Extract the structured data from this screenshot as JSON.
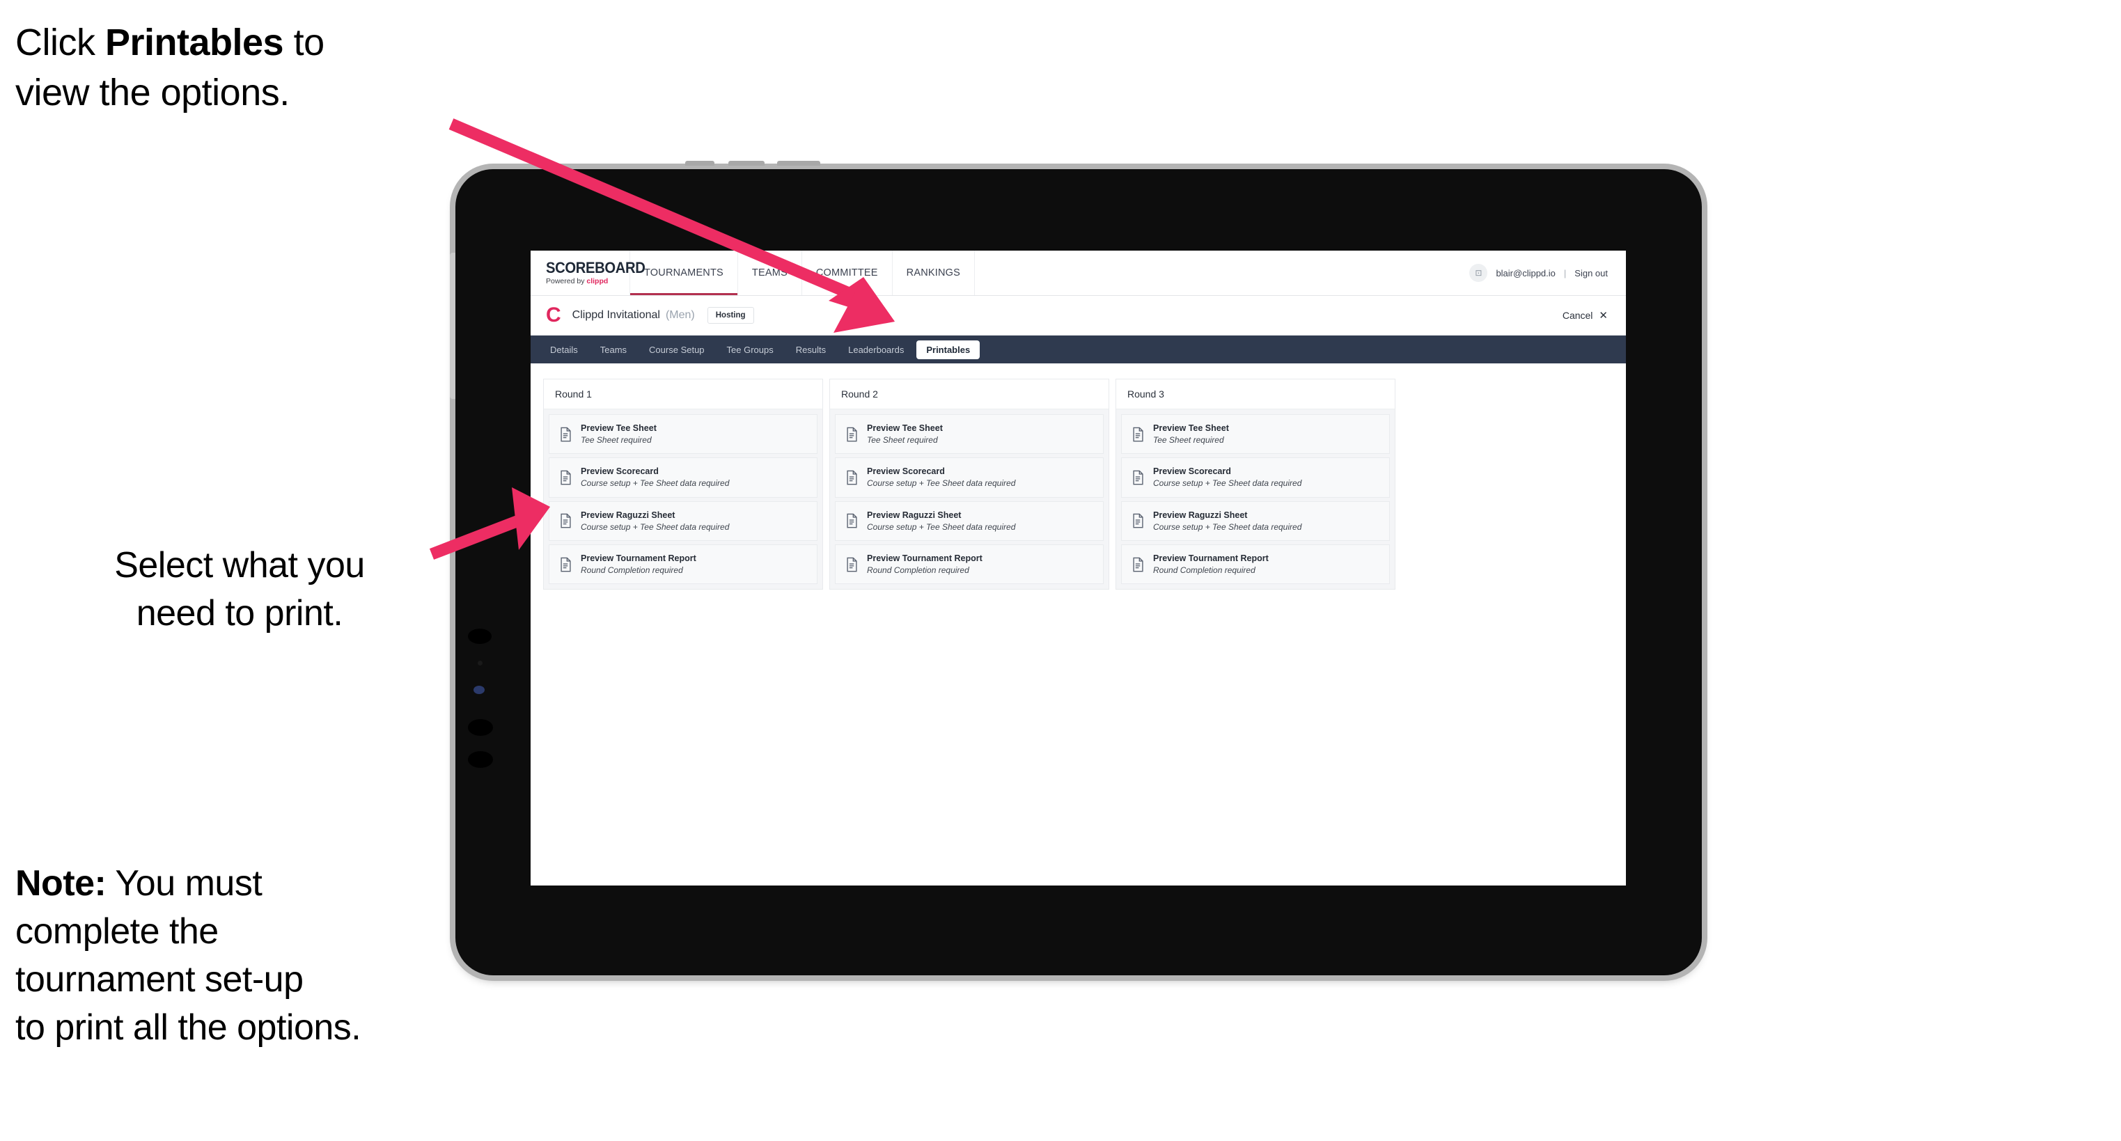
{
  "annotations": {
    "click_printables": {
      "line1_pre": "Click ",
      "line1_strong": "Printables",
      "line1_post": " to",
      "line2": "view the options."
    },
    "select_print": {
      "line1": "Select what you",
      "line2": "need to print."
    },
    "note": {
      "label": "Note:",
      "line1_rest": " You must",
      "line2": "complete the",
      "line3": "tournament set-up",
      "line4": "to print all the options."
    }
  },
  "colors": {
    "arrow_pink": "#ed2d63",
    "tabs_bar": "#2f3a4f",
    "brand_pink": "#e0275e",
    "active_underline": "#b3304f",
    "card_bg": "#f8f9fa",
    "round_body_bg": "#f4f5f7"
  },
  "app": {
    "brand": {
      "title": "SCOREBOARD",
      "powered_prefix": "Powered by ",
      "powered_name": "clippd"
    },
    "nav": [
      {
        "label": "TOURNAMENTS",
        "active": true
      },
      {
        "label": "TEAMS",
        "active": false
      },
      {
        "label": "COMMITTEE",
        "active": false
      },
      {
        "label": "RANKINGS",
        "active": false
      }
    ],
    "account": {
      "avatar_glyph": "⊡",
      "email": "blair@clippd.io",
      "separator": "|",
      "sign_out": "Sign out"
    },
    "tournament": {
      "logo_letter": "C",
      "name": "Clippd Invitational",
      "gender": "(Men)",
      "status_badge": "Hosting",
      "cancel_label": "Cancel",
      "cancel_icon": "✕"
    },
    "tabs": [
      {
        "label": "Details",
        "active": false
      },
      {
        "label": "Teams",
        "active": false
      },
      {
        "label": "Course Setup",
        "active": false
      },
      {
        "label": "Tee Groups",
        "active": false
      },
      {
        "label": "Results",
        "active": false
      },
      {
        "label": "Leaderboards",
        "active": false
      },
      {
        "label": "Printables",
        "active": true
      }
    ],
    "rounds": [
      {
        "title": "Round 1",
        "items": [
          {
            "title": "Preview Tee Sheet",
            "subtitle": "Tee Sheet required"
          },
          {
            "title": "Preview Scorecard",
            "subtitle": "Course setup + Tee Sheet data required"
          },
          {
            "title": "Preview Raguzzi Sheet",
            "subtitle": "Course setup + Tee Sheet data required"
          },
          {
            "title": "Preview Tournament Report",
            "subtitle": "Round Completion required"
          }
        ]
      },
      {
        "title": "Round 2",
        "items": [
          {
            "title": "Preview Tee Sheet",
            "subtitle": "Tee Sheet required"
          },
          {
            "title": "Preview Scorecard",
            "subtitle": "Course setup + Tee Sheet data required"
          },
          {
            "title": "Preview Raguzzi Sheet",
            "subtitle": "Course setup + Tee Sheet data required"
          },
          {
            "title": "Preview Tournament Report",
            "subtitle": "Round Completion required"
          }
        ]
      },
      {
        "title": "Round 3",
        "items": [
          {
            "title": "Preview Tee Sheet",
            "subtitle": "Tee Sheet required"
          },
          {
            "title": "Preview Scorecard",
            "subtitle": "Course setup + Tee Sheet data required"
          },
          {
            "title": "Preview Raguzzi Sheet",
            "subtitle": "Course setup + Tee Sheet data required"
          },
          {
            "title": "Preview Tournament Report",
            "subtitle": "Round Completion required"
          }
        ]
      }
    ]
  }
}
